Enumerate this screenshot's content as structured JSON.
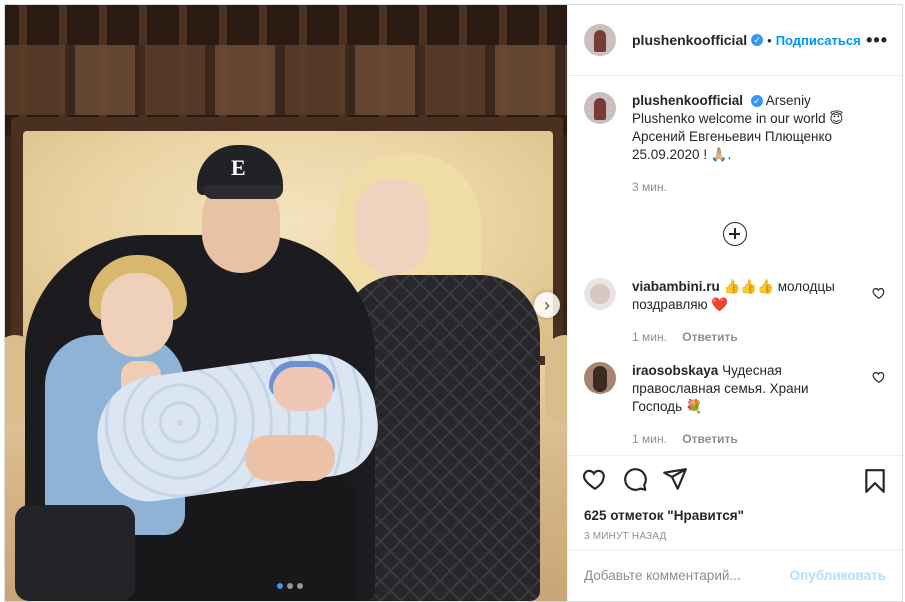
{
  "post": {
    "author": "plushenkoofficial",
    "separator": "•",
    "follow_label": "Подписаться",
    "more_label": "•••",
    "caption": {
      "username": "plushenkoofficial",
      "line1": "Arseniy",
      "line2": "Plushenko welcome in our world 😇",
      "line3": "Арсений Евгеньевич Плющенко",
      "line4": "25.09.2020 ! 🙏🏼.",
      "time": "3 мин."
    },
    "comments": [
      {
        "username": "viabambini.ru",
        "text": "👍👍👍 молодцы поздравляю ❤️",
        "time": "1 мин.",
        "reply": "Ответить"
      },
      {
        "username": "iraosobskaya",
        "text": "Чудесная православная семья. Храни Господь 💐",
        "time": "1 мин.",
        "reply": "Ответить"
      }
    ],
    "likes": "625 отметок \"Нравится\"",
    "timestamp": "3 МИНУТ НАЗАД",
    "add_comment_placeholder": "Добавьте комментарий...",
    "publish_label": "Опубликовать",
    "carousel": {
      "current": 1,
      "total": 3
    },
    "colors": {
      "accent": "#0095f6",
      "publish_disabled": "#b2dffc",
      "verified": "#3897f0"
    }
  }
}
